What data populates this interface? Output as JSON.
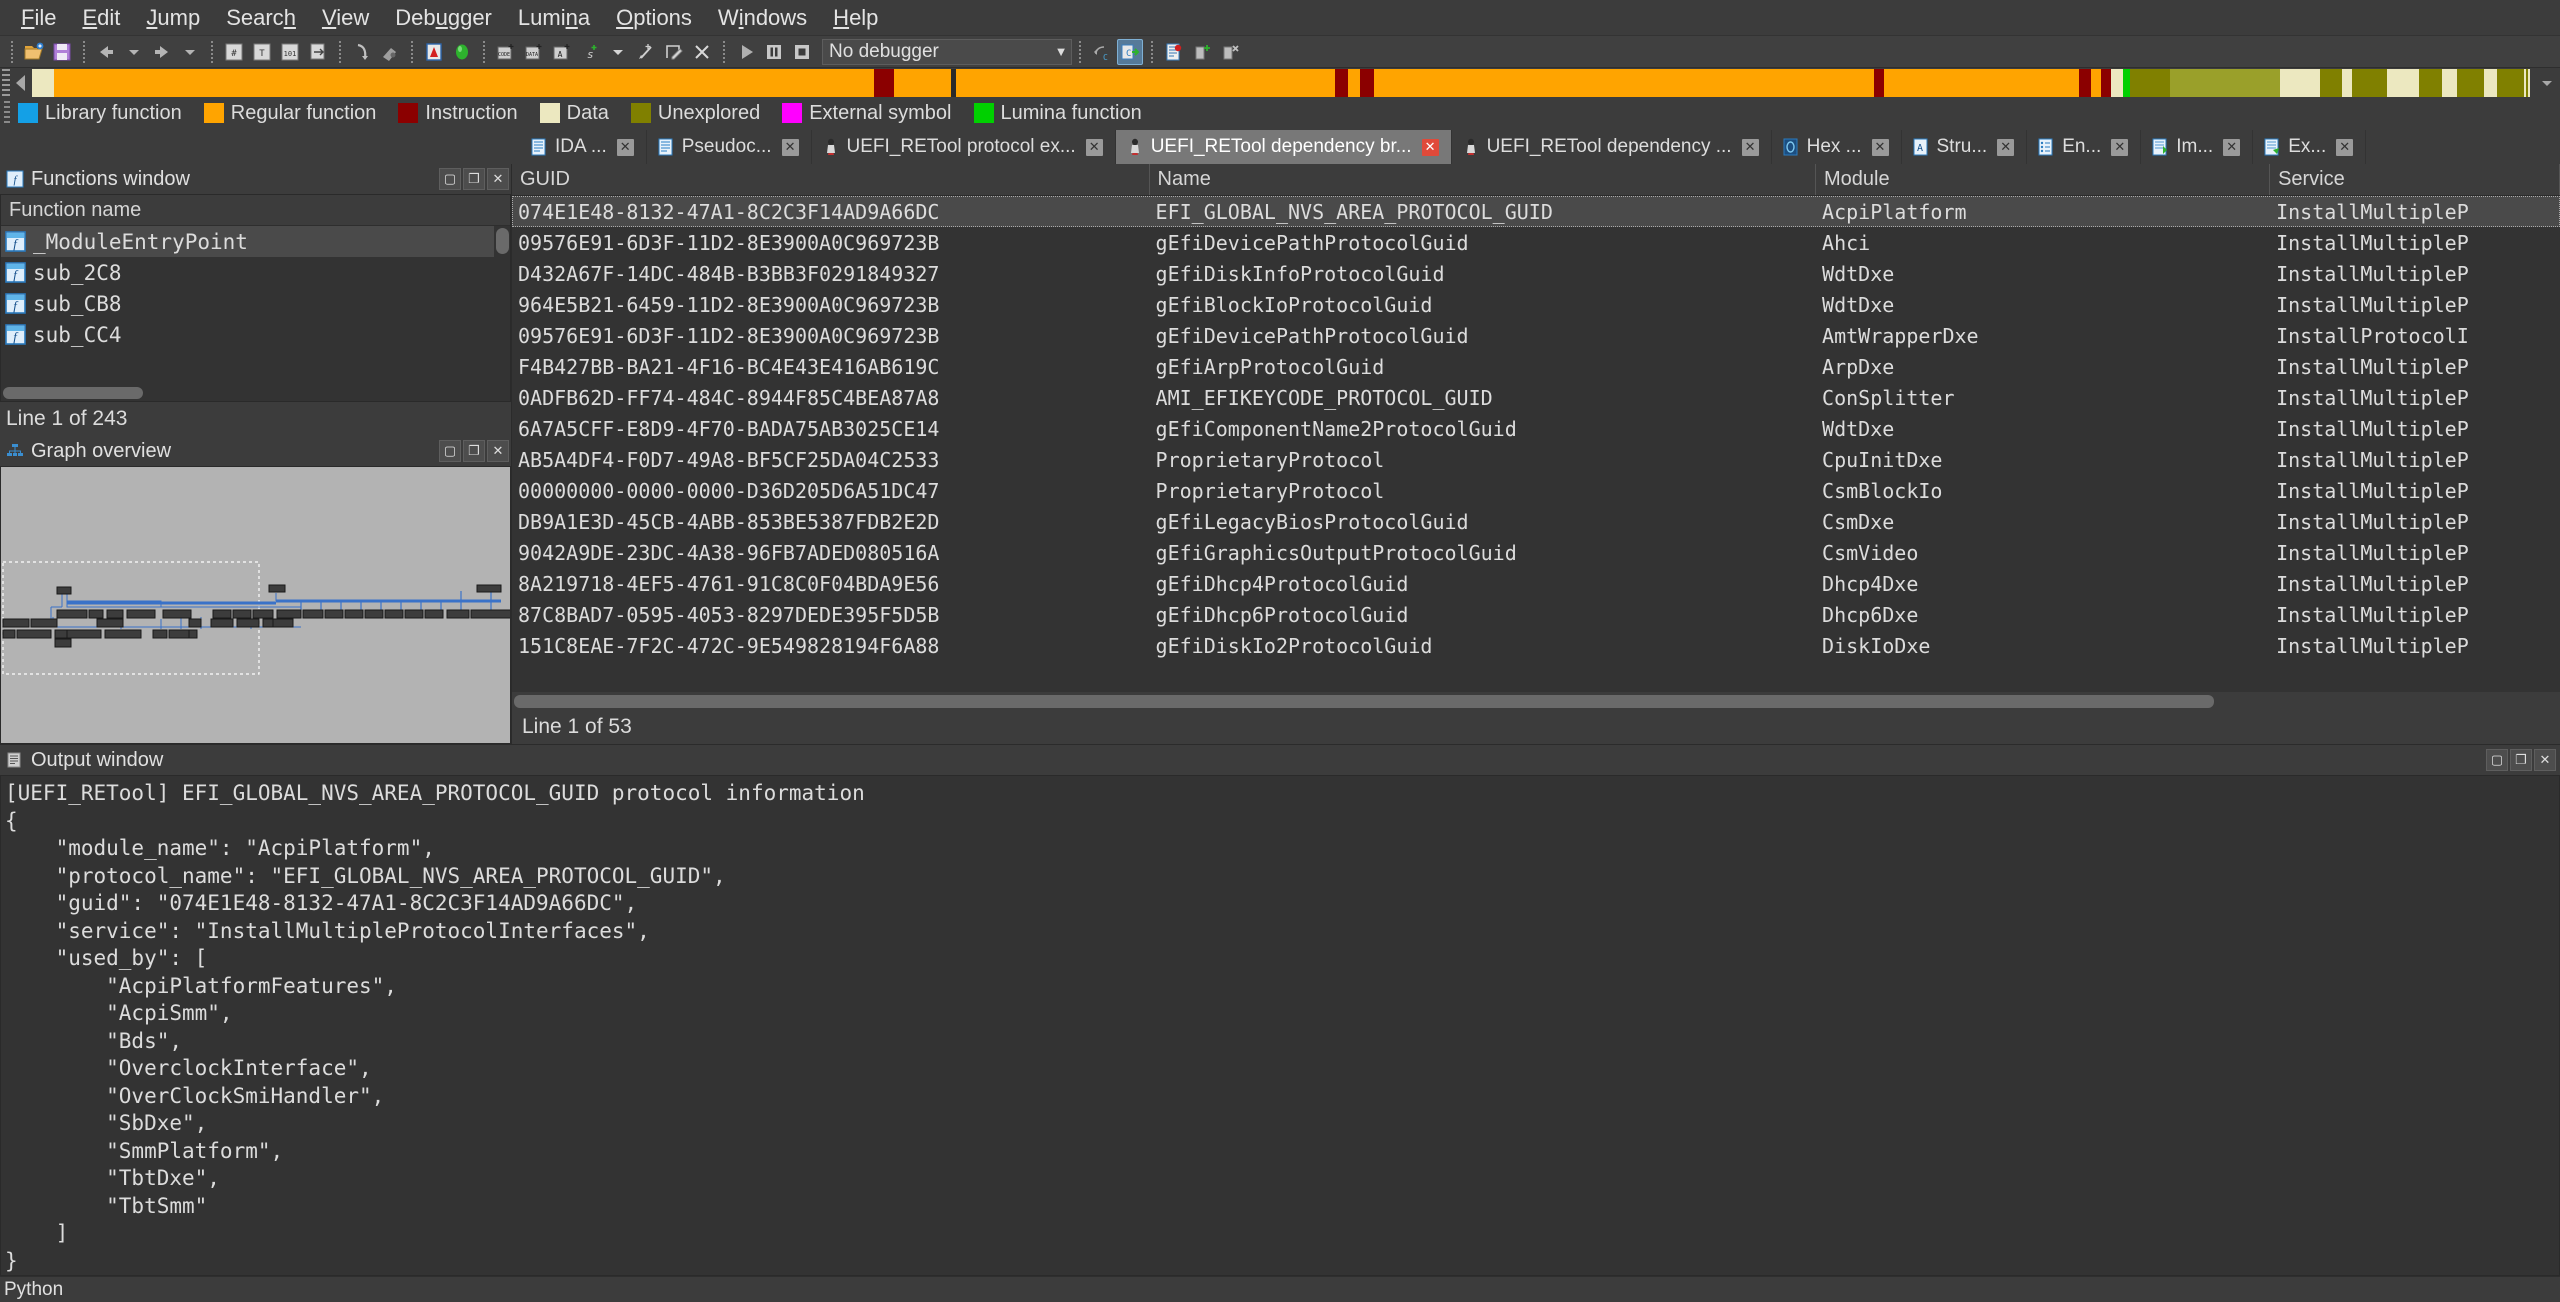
{
  "menubar": {
    "items": [
      "File",
      "Edit",
      "Jump",
      "Search",
      "View",
      "Debugger",
      "Lumina",
      "Options",
      "Windows",
      "Help"
    ]
  },
  "toolbar": {
    "debugger_value": "No debugger",
    "icons": [
      "open-folder-icon",
      "save-icon",
      "back-arrow-icon",
      "back-dropdown-icon",
      "forward-arrow-icon",
      "forward-dropdown-icon",
      "search-hex-icon",
      "search-text-icon",
      "search-immediate-icon",
      "search-next-icon",
      "jump-icon",
      "search-binary-icon",
      "analyze-icon",
      "lumina-icon",
      "make-code-icon",
      "make-data-icon",
      "make-ascii-icon",
      "make-struct-icon",
      "struct-dropdown-icon",
      "undefine-icon",
      "edit-func-icon",
      "delete-icon",
      "run-icon",
      "pause-icon",
      "stop-icon",
      "step-over-icon",
      "step-into-icon",
      "breakpoint-list-icon",
      "add-breakpoint-icon",
      "delete-breakpoint-icon"
    ]
  },
  "navband": {
    "segments": [
      {
        "color": "#ece8c0",
        "width": 0.9
      },
      {
        "color": "#ffa400",
        "width": 32.8
      },
      {
        "color": "#8b0000",
        "width": 0.8
      },
      {
        "color": "#ffa400",
        "width": 2.3
      },
      {
        "color": "#2a2a2a",
        "width": 0.18
      },
      {
        "color": "#ffa400",
        "width": 15.2
      },
      {
        "color": "#8b0000",
        "width": 0.5
      },
      {
        "color": "#ffa400",
        "width": 0.5
      },
      {
        "color": "#8b0000",
        "width": 0.55
      },
      {
        "color": "#ffa400",
        "width": 20.0
      },
      {
        "color": "#8b0000",
        "width": 0.4
      },
      {
        "color": "#ffa400",
        "width": 7.8
      },
      {
        "color": "#8b0000",
        "width": 0.5
      },
      {
        "color": "#ffa400",
        "width": 0.4
      },
      {
        "color": "#8b0000",
        "width": 0.4
      },
      {
        "color": "#ece8c0",
        "width": 0.5
      },
      {
        "color": "#00d000",
        "width": 0.25
      },
      {
        "color": "#808000",
        "width": 1.6
      },
      {
        "color": "#9aa02a",
        "width": 4.4
      },
      {
        "color": "#ece8c0",
        "width": 1.6
      },
      {
        "color": "#808000",
        "width": 0.9
      },
      {
        "color": "#ece8c0",
        "width": 0.4
      },
      {
        "color": "#808000",
        "width": 1.4
      },
      {
        "color": "#ece8c0",
        "width": 1.3
      },
      {
        "color": "#808000",
        "width": 0.9
      },
      {
        "color": "#ece8c0",
        "width": 0.6
      },
      {
        "color": "#808000",
        "width": 1.1
      },
      {
        "color": "#ece8c0",
        "width": 0.5
      },
      {
        "color": "#808000",
        "width": 1.0
      }
    ]
  },
  "legend": {
    "items": [
      {
        "label": "Library function",
        "color": "#14a0e6"
      },
      {
        "label": "Regular function",
        "color": "#ffa400"
      },
      {
        "label": "Instruction",
        "color": "#8b0000"
      },
      {
        "label": "Data",
        "color": "#ece8c0"
      },
      {
        "label": "Unexplored",
        "color": "#808000"
      },
      {
        "label": "External symbol",
        "color": "#ff00ff"
      },
      {
        "label": "Lumina function",
        "color": "#00d000"
      }
    ]
  },
  "tabs": [
    {
      "label": "IDA ...",
      "icon": "ida-view-icon",
      "active": false
    },
    {
      "label": "Pseudoc...",
      "icon": "pseudocode-icon",
      "active": false
    },
    {
      "label": "UEFI_RETool protocol ex...",
      "icon": "python-script-icon",
      "active": false
    },
    {
      "label": "UEFI_RETool dependency br...",
      "icon": "python-script-icon",
      "active": true
    },
    {
      "label": "UEFI_RETool dependency ...",
      "icon": "python-script-icon",
      "active": false
    },
    {
      "label": "Hex ...",
      "icon": "hex-view-icon",
      "active": false
    },
    {
      "label": "Stru...",
      "icon": "structures-icon",
      "active": false
    },
    {
      "label": "En...",
      "icon": "enums-icon",
      "active": false
    },
    {
      "label": "Im...",
      "icon": "imports-icon",
      "active": false
    },
    {
      "label": "Ex...",
      "icon": "exports-icon",
      "active": false
    }
  ],
  "functions_window": {
    "title": "Functions window",
    "column_header": "Function name",
    "rows": [
      {
        "name": "_ModuleEntryPoint",
        "selected": true
      },
      {
        "name": "sub_2C8",
        "selected": false
      },
      {
        "name": "sub_CB8",
        "selected": false
      },
      {
        "name": "sub_CC4",
        "selected": false
      }
    ],
    "status": "Line 1 of 243"
  },
  "graph_overview": {
    "title": "Graph overview"
  },
  "protocol_table": {
    "columns": [
      "GUID",
      "Name",
      "Module",
      "Service"
    ],
    "rows": [
      {
        "guid": "074E1E48-8132-47A1-8C2C3F14AD9A66DC",
        "name": "EFI_GLOBAL_NVS_AREA_PROTOCOL_GUID",
        "module": "AcpiPlatform",
        "service": "InstallMultipleP",
        "selected": true
      },
      {
        "guid": "09576E91-6D3F-11D2-8E3900A0C969723B",
        "name": "gEfiDevicePathProtocolGuid",
        "module": "Ahci",
        "service": "InstallMultipleP",
        "selected": false
      },
      {
        "guid": "D432A67F-14DC-484B-B3BB3F0291849327",
        "name": "gEfiDiskInfoProtocolGuid",
        "module": "WdtDxe",
        "service": "InstallMultipleP",
        "selected": false
      },
      {
        "guid": "964E5B21-6459-11D2-8E3900A0C969723B",
        "name": "gEfiBlockIoProtocolGuid",
        "module": "WdtDxe",
        "service": "InstallMultipleP",
        "selected": false
      },
      {
        "guid": "09576E91-6D3F-11D2-8E3900A0C969723B",
        "name": "gEfiDevicePathProtocolGuid",
        "module": "AmtWrapperDxe",
        "service": "InstallProtocolI",
        "selected": false
      },
      {
        "guid": "F4B427BB-BA21-4F16-BC4E43E416AB619C",
        "name": "gEfiArpProtocolGuid",
        "module": "ArpDxe",
        "service": "InstallMultipleP",
        "selected": false
      },
      {
        "guid": "0ADFB62D-FF74-484C-8944F85C4BEA87A8",
        "name": "AMI_EFIKEYCODE_PROTOCOL_GUID",
        "module": "ConSplitter",
        "service": "InstallMultipleP",
        "selected": false
      },
      {
        "guid": "6A7A5CFF-E8D9-4F70-BADA75AB3025CE14",
        "name": "gEfiComponentName2ProtocolGuid",
        "module": "WdtDxe",
        "service": "InstallMultipleP",
        "selected": false
      },
      {
        "guid": "AB5A4DF4-F0D7-49A8-BF5CF25DA04C2533",
        "name": "ProprietaryProtocol",
        "module": "CpuInitDxe",
        "service": "InstallMultipleP",
        "selected": false
      },
      {
        "guid": "00000000-0000-0000-D36D205D6A51DC47",
        "name": "ProprietaryProtocol",
        "module": "CsmBlockIo",
        "service": "InstallMultipleP",
        "selected": false
      },
      {
        "guid": "DB9A1E3D-45CB-4ABB-853BE5387FDB2E2D",
        "name": "gEfiLegacyBiosProtocolGuid",
        "module": "CsmDxe",
        "service": "InstallMultipleP",
        "selected": false
      },
      {
        "guid": "9042A9DE-23DC-4A38-96FB7ADED080516A",
        "name": "gEfiGraphicsOutputProtocolGuid",
        "module": "CsmVideo",
        "service": "InstallMultipleP",
        "selected": false
      },
      {
        "guid": "8A219718-4EF5-4761-91C8C0F04BDA9E56",
        "name": "gEfiDhcp4ProtocolGuid",
        "module": "Dhcp4Dxe",
        "service": "InstallMultipleP",
        "selected": false
      },
      {
        "guid": "87C8BAD7-0595-4053-8297DEDE395F5D5B",
        "name": "gEfiDhcp6ProtocolGuid",
        "module": "Dhcp6Dxe",
        "service": "InstallMultipleP",
        "selected": false
      },
      {
        "guid": "151C8EAE-7F2C-472C-9E549828194F6A88",
        "name": "gEfiDiskIo2ProtocolGuid",
        "module": "DiskIoDxe",
        "service": "InstallMultipleP",
        "selected": false
      }
    ],
    "status": "Line 1 of 53"
  },
  "output_window": {
    "title": "Output window",
    "text": "[UEFI_RETool] EFI_GLOBAL_NVS_AREA_PROTOCOL_GUID protocol information\n{\n    \"module_name\": \"AcpiPlatform\",\n    \"protocol_name\": \"EFI_GLOBAL_NVS_AREA_PROTOCOL_GUID\",\n    \"guid\": \"074E1E48-8132-47A1-8C2C3F14AD9A66DC\",\n    \"service\": \"InstallMultipleProtocolInterfaces\",\n    \"used_by\": [\n        \"AcpiPlatformFeatures\",\n        \"AcpiSmm\",\n        \"Bds\",\n        \"OverclockInterface\",\n        \"OverClockSmiHandler\",\n        \"SbDxe\",\n        \"SmmPlatform\",\n        \"TbtDxe\",\n        \"TbtSmm\"\n    ]\n}"
  },
  "statusbar": {
    "label": "Python"
  }
}
